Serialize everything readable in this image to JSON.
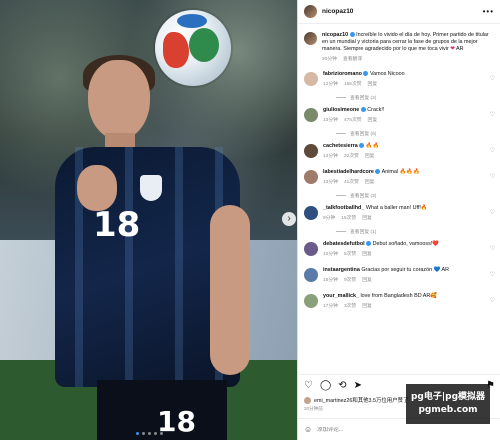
{
  "post": {
    "username": "nicopaz10",
    "caption_user": "nicopaz10",
    "caption_text": "Increíble lo vivido el día de hoy. Primer partido de titular en un mundial y victoria para cerrar la fase de grupos de la mejor manera. Siempre agradecido por lo que me toca vivir",
    "caption_tags": "AR",
    "caption_time": "20分钟",
    "caption_translate": "查看翻译",
    "more": "•••"
  },
  "photo": {
    "jersey_number": "18",
    "shorts_number": "18",
    "carousel_pages": 5,
    "carousel_active": 0
  },
  "comments": [
    {
      "user": "fabrizioromano",
      "verified": true,
      "text": "Vamos Nicooo",
      "time": "12分钟",
      "likes": "155次赞",
      "reply": "回复",
      "replies": "查看回复 (2)",
      "avatar_color": "#d7b8a3"
    },
    {
      "user": "giuliosimeone",
      "verified": true,
      "text": "Crack!!",
      "time": "13分钟",
      "likes": "475次赞",
      "reply": "回复",
      "replies": "查看回复 (6)",
      "avatar_color": "#7a8a6a"
    },
    {
      "user": "cachetesierra",
      "verified": true,
      "text": "🔥🔥",
      "time": "13分钟",
      "likes": "32次赞",
      "reply": "回复",
      "replies": "",
      "avatar_color": "#5e4a3a"
    },
    {
      "user": "labestiadelhardcore",
      "verified": true,
      "text": "Animal 🔥🔥🔥",
      "time": "13分钟",
      "likes": "41次赞",
      "reply": "回复",
      "replies": "查看回复 (3)",
      "avatar_color": "#a07a6a"
    },
    {
      "user": "_talkfootballhd_",
      "verified": false,
      "text": "What a baller man! Uff!🔥",
      "time": "9分钟",
      "likes": "15次赞",
      "reply": "回复",
      "replies": "查看回复 (1)",
      "avatar_color": "#2f4f7f"
    },
    {
      "user": "debatesdefutbol",
      "verified": true,
      "text": "Debut soñado, vamooss!❤️",
      "time": "10分钟",
      "likes": "5次赞",
      "reply": "回复",
      "replies": "",
      "avatar_color": "#6b5b8a"
    },
    {
      "user": "instaargentina",
      "verified": false,
      "text": "Gracias por seguir tu corazón 💙 AR",
      "time": "15分钟",
      "likes": "9次赞",
      "reply": "回复",
      "replies": "",
      "avatar_color": "#5a7aa8"
    },
    {
      "user": "your_mallick_",
      "verified": false,
      "text": "love from Bangladesh BD AR🥰",
      "time": "17分钟",
      "likes": "3次赞",
      "reply": "回复",
      "replies": "",
      "avatar_color": "#8aa07a"
    }
  ],
  "actions": {
    "like_icon": "heart-icon",
    "comment_icon": "comment-icon",
    "share_icon": "repost-icon",
    "send_icon": "send-icon",
    "save_icon": "bookmark-icon"
  },
  "likes_line": "emi_martinez26和其他3.5万位用户赞了",
  "date_line": "20分钟前",
  "add_comment": {
    "placeholder": "添加评论..."
  },
  "watermark": {
    "line1": "pg电子|pg模拟器",
    "line2": "pgmeb.com"
  }
}
